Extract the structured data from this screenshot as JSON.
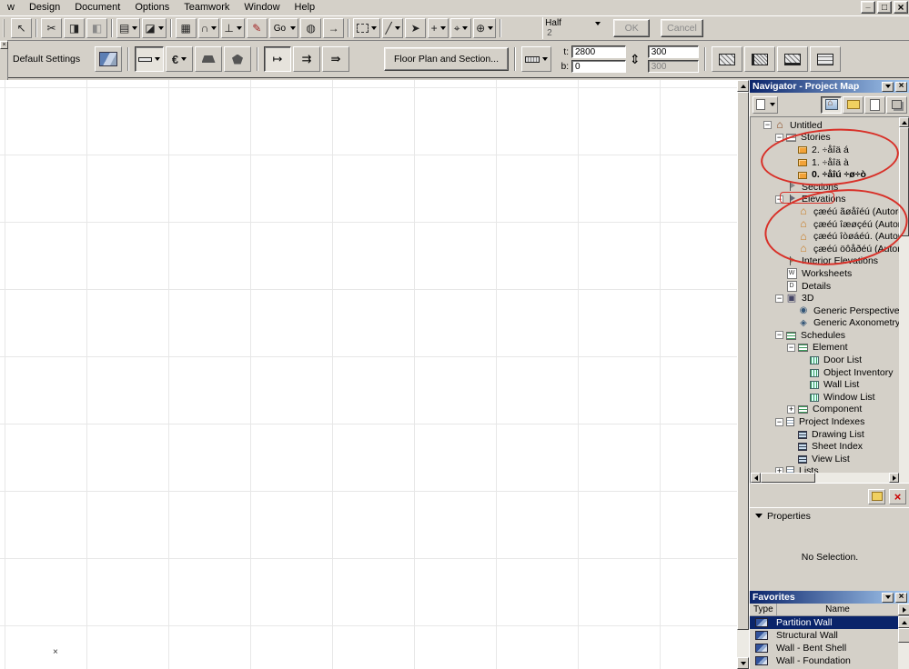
{
  "menu": {
    "items": [
      "w",
      "Design",
      "Document",
      "Options",
      "Teamwork",
      "Window",
      "Help"
    ]
  },
  "toolbar1": {
    "items": [
      {
        "type": "grip"
      },
      {
        "type": "btn",
        "name": "select-arrow",
        "glyph": "↖"
      },
      {
        "type": "sep"
      },
      {
        "type": "btn",
        "name": "cut",
        "glyph": "✂"
      },
      {
        "type": "btn",
        "name": "copy",
        "glyph": "◨"
      },
      {
        "type": "btn",
        "name": "paste",
        "glyph": "◧",
        "disabled": true
      },
      {
        "type": "sep"
      },
      {
        "type": "btn",
        "name": "element-settings",
        "glyph": "▤",
        "dropdown": true
      },
      {
        "type": "btn",
        "name": "selection-options",
        "glyph": "◪",
        "dropdown": true
      },
      {
        "type": "sep"
      },
      {
        "type": "btn",
        "name": "grid-display",
        "glyph": "▦"
      },
      {
        "type": "btn",
        "name": "snap-magnet",
        "glyph": "∩",
        "dropdown": true
      },
      {
        "type": "btn",
        "name": "gravity",
        "glyph": "⊥",
        "dropdown": true
      },
      {
        "type": "btn",
        "name": "pen-tool",
        "glyph": "✎",
        "color": "#a22222"
      },
      {
        "type": "btn",
        "name": "go-to",
        "label": "Go",
        "dropdown": true
      },
      {
        "type": "btn",
        "name": "globe",
        "glyph": "◍"
      },
      {
        "type": "btn",
        "name": "navigate",
        "glyph": "→"
      },
      {
        "type": "sep"
      },
      {
        "type": "btn",
        "name": "marquee",
        "glyph": "",
        "dropdown": true,
        "wide": true
      },
      {
        "type": "btn",
        "name": "line-tool",
        "glyph": "╱",
        "dropdown": true
      },
      {
        "type": "btn",
        "name": "arrow-tool",
        "glyph": "➤"
      },
      {
        "type": "btn",
        "name": "add-tool",
        "glyph": "+",
        "dropdown": true
      },
      {
        "type": "btn",
        "name": "zoom-tool",
        "glyph": "⌖",
        "dropdown": true
      },
      {
        "type": "btn",
        "name": "pan-tool",
        "glyph": "⊕",
        "dropdown": true
      },
      {
        "type": "sep"
      },
      {
        "type": "scale",
        "name": "scale",
        "label": "Half",
        "value": "2"
      },
      {
        "type": "ok",
        "label": "OK"
      },
      {
        "type": "cancel",
        "label": "Cancel"
      }
    ]
  },
  "infobox": {
    "default_settings": "Default Settings",
    "floor_plan_button": "Floor Plan and Section...",
    "t_label": "t:",
    "b_label": "b:",
    "t_value": "2800",
    "b_value": "0",
    "thickness_value": "300",
    "thickness_value2": "300"
  },
  "canvas": {
    "origin_marker": "×"
  },
  "navigator": {
    "title": "Navigator - Project Map",
    "tree": [
      {
        "id": "untitled",
        "label": "Untitled",
        "level": 0,
        "icon": "home",
        "expand": "minus"
      },
      {
        "id": "stories",
        "label": "Stories",
        "level": 1,
        "icon": "stories",
        "expand": "minus"
      },
      {
        "id": "story-2",
        "label": "2. ÷åîä á",
        "level": 2,
        "icon": "story"
      },
      {
        "id": "story-1",
        "label": "1. ÷åîä à",
        "level": 2,
        "icon": "story"
      },
      {
        "id": "story-0",
        "label": "0. ÷åîú ÷ø÷ò",
        "level": 2,
        "icon": "story",
        "bold": true
      },
      {
        "id": "sections",
        "label": "Sections",
        "level": 1,
        "icon": "section"
      },
      {
        "id": "elevations",
        "label": "Elevations",
        "level": 1,
        "icon": "elevation",
        "expand": "minus"
      },
      {
        "id": "elevation-south",
        "label": "çæéú ãøåîéú (Autoreb",
        "level": 2,
        "icon": "elev-item"
      },
      {
        "id": "elevation-east",
        "label": "çæéú îæøçéú (Autoret",
        "level": 2,
        "icon": "elev-item"
      },
      {
        "id": "elevation-west",
        "label": "çæéú îòøáéú. (Autoret",
        "level": 2,
        "icon": "elev-item"
      },
      {
        "id": "elevation-north",
        "label": "çæéú öôåðéú (Autorel",
        "level": 2,
        "icon": "elev-item"
      },
      {
        "id": "interior-elevations",
        "label": "Interior Elevations",
        "level": 1,
        "icon": "interior"
      },
      {
        "id": "worksheets",
        "label": "Worksheets",
        "level": 1,
        "icon": "worksheet"
      },
      {
        "id": "details",
        "label": "Details",
        "level": 1,
        "icon": "detail"
      },
      {
        "id": "3d",
        "label": "3D",
        "level": 1,
        "icon": "threed",
        "expand": "minus"
      },
      {
        "id": "generic-perspective",
        "label": "Generic Perspective",
        "level": 2,
        "icon": "perspective"
      },
      {
        "id": "generic-axonometry",
        "label": "Generic Axonometry",
        "level": 2,
        "icon": "axono"
      },
      {
        "id": "schedules",
        "label": "Schedules",
        "level": 1,
        "icon": "schedule",
        "expand": "minus"
      },
      {
        "id": "element",
        "label": "Element",
        "level": 2,
        "icon": "element",
        "expand": "minus"
      },
      {
        "id": "door-list",
        "label": "Door List",
        "level": 3,
        "icon": "list-green"
      },
      {
        "id": "object-inventory",
        "label": "Object Inventory",
        "level": 3,
        "icon": "list-green"
      },
      {
        "id": "wall-list",
        "label": "Wall List",
        "level": 3,
        "icon": "list-green"
      },
      {
        "id": "window-list",
        "label": "Window List",
        "level": 3,
        "icon": "list-green"
      },
      {
        "id": "component",
        "label": "Component",
        "level": 2,
        "icon": "element",
        "expand": "plus"
      },
      {
        "id": "project-indexes",
        "label": "Project Indexes",
        "level": 1,
        "icon": "indexes",
        "expand": "minus"
      },
      {
        "id": "drawing-list",
        "label": "Drawing List",
        "level": 2,
        "icon": "list-dark"
      },
      {
        "id": "sheet-index",
        "label": "Sheet Index",
        "level": 2,
        "icon": "list-dark"
      },
      {
        "id": "view-list",
        "label": "View List",
        "level": 2,
        "icon": "list-dark"
      },
      {
        "id": "lists",
        "label": "Lists",
        "level": 1,
        "icon": "lists",
        "expand": "plus"
      }
    ]
  },
  "properties": {
    "title": "Properties",
    "empty_text": "No Selection."
  },
  "favorites": {
    "title": "Favorites",
    "columns": [
      "Type",
      "Name"
    ],
    "rows": [
      {
        "id": "partition-wall",
        "name": "Partition Wall",
        "selected": true
      },
      {
        "id": "structural-wall",
        "name": "Structural Wall"
      },
      {
        "id": "wall-bent-shell",
        "name": "Wall - Bent Shell"
      },
      {
        "id": "wall-foundation",
        "name": "Wall - Foundation"
      }
    ]
  },
  "annotation_color": "#d83028"
}
